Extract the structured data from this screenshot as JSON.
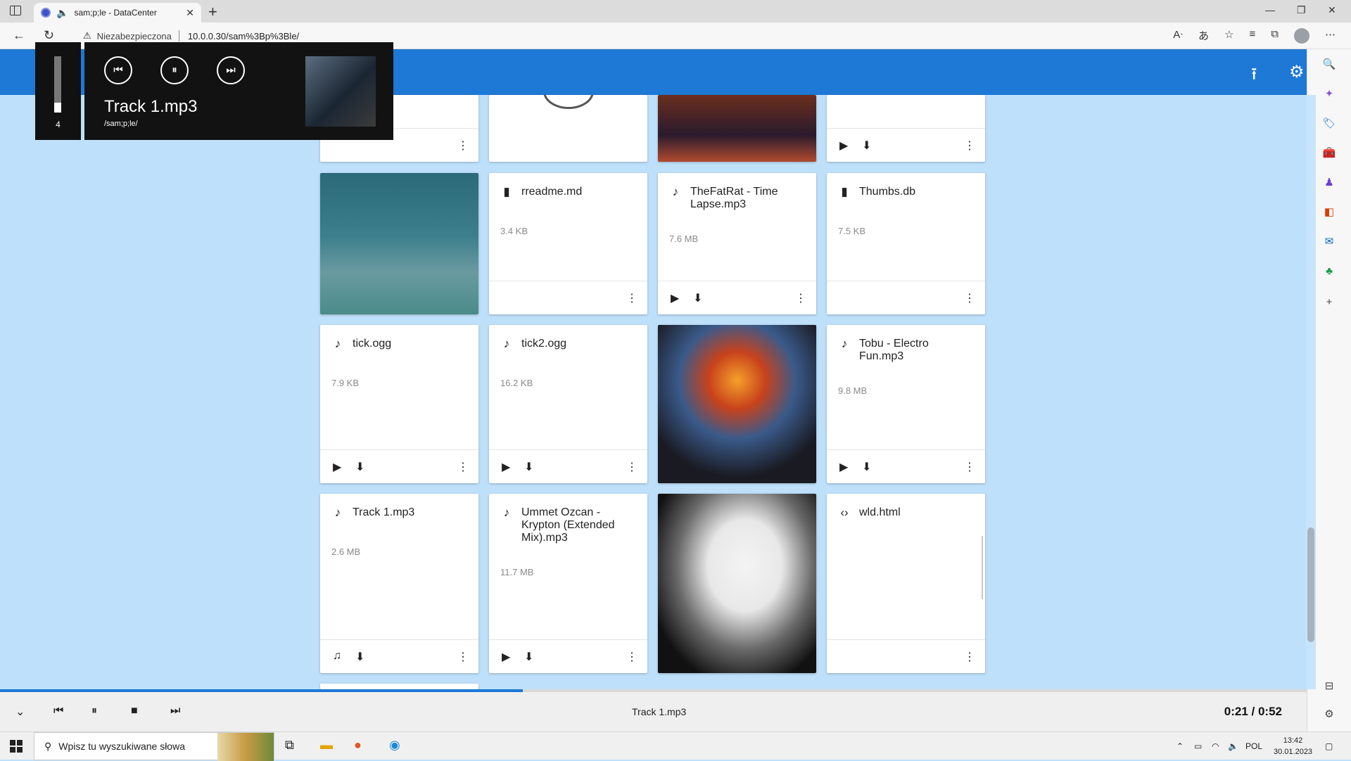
{
  "browser": {
    "tab_title": "sam;p;le - DataCenter",
    "insecure_label": "Niezabezpieczona",
    "url": "10.0.0.30/sam%3Bp%3Ble/"
  },
  "overlay": {
    "volume_value": "4",
    "track_title": "Track 1.mp3",
    "track_path": "/sam;p;le/"
  },
  "cards": [
    {
      "name": "rreadme.md",
      "size": "3.4 KB",
      "icon": "file-icon"
    },
    {
      "name": "TheFatRat - Time Lapse.mp3",
      "size": "7.6 MB",
      "icon": "music-note-icon"
    },
    {
      "name": "Thumbs.db",
      "size": "7.5 KB",
      "icon": "file-icon"
    },
    {
      "name": "tick.ogg",
      "size": "7.9 KB",
      "icon": "music-note-icon"
    },
    {
      "name": "tick2.ogg",
      "size": "16.2 KB",
      "icon": "music-note-icon"
    },
    {
      "name": "Tobu - Electro Fun.mp3",
      "size": "9.8 MB",
      "icon": "music-note-icon"
    },
    {
      "name": "Track 1.mp3",
      "size": "2.6 MB",
      "icon": "music-note-icon"
    },
    {
      "name": "Ummet Ozcan - Krypton (Extended Mix).mp3",
      "size": "11.7 MB",
      "icon": "music-note-icon"
    },
    {
      "name": "wld.html",
      "size": "",
      "icon": "code-icon"
    }
  ],
  "player": {
    "track": "Track 1.mp3",
    "time": "0:21 / 0:52",
    "progress_fraction": 0.4
  },
  "taskbar": {
    "search_placeholder": "Wpisz tu wyszukiwane słowa",
    "lang": "POL",
    "time": "13:42",
    "date": "30.01.2023"
  },
  "colors": {
    "accent": "#1e78d6",
    "background": "#bfe0fa"
  }
}
